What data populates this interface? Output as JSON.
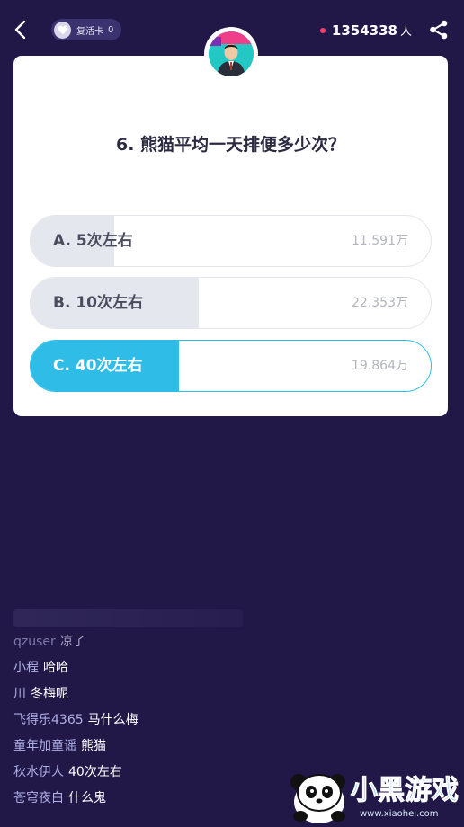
{
  "header": {
    "revive_card_label": "复活卡",
    "revive_card_count": "0",
    "online_count": "1354338",
    "online_unit": "人"
  },
  "question": {
    "text": "6. 熊猫平均一天排便多少次？"
  },
  "options": [
    {
      "label": "A. 5次左右",
      "votes": "11.591万",
      "share": 0.21,
      "selected": false
    },
    {
      "label": "B. 10次左右",
      "votes": "22.353万",
      "share": 0.42,
      "selected": false
    },
    {
      "label": "C. 40次左右",
      "votes": "19.864万",
      "share": 0.37,
      "selected": true
    }
  ],
  "colors": {
    "fill_default": "#e4e7ed",
    "fill_selected": "#2fbde8",
    "background": "#211848"
  },
  "comments": [
    {
      "user": "qzuser",
      "text": "凉了",
      "dim": true
    },
    {
      "user": "小程",
      "text": "哈哈",
      "dim": false
    },
    {
      "user": "川",
      "text": "冬梅呢",
      "dim": false
    },
    {
      "user": "飞得乐4365",
      "text": "马什么梅",
      "dim": false
    },
    {
      "user": "童年加童谣",
      "text": "熊猫",
      "dim": false
    },
    {
      "user": "秋水伊人",
      "text": "40次左右",
      "dim": false
    },
    {
      "user": "苍穹夜白",
      "text": "什么鬼",
      "dim": false
    }
  ],
  "watermark": {
    "title": "小黑游戏",
    "url": "www.xiaohei.com"
  },
  "icons": {
    "back": "chevron-left-icon",
    "revive": "heart-icon",
    "share": "share-icon"
  }
}
